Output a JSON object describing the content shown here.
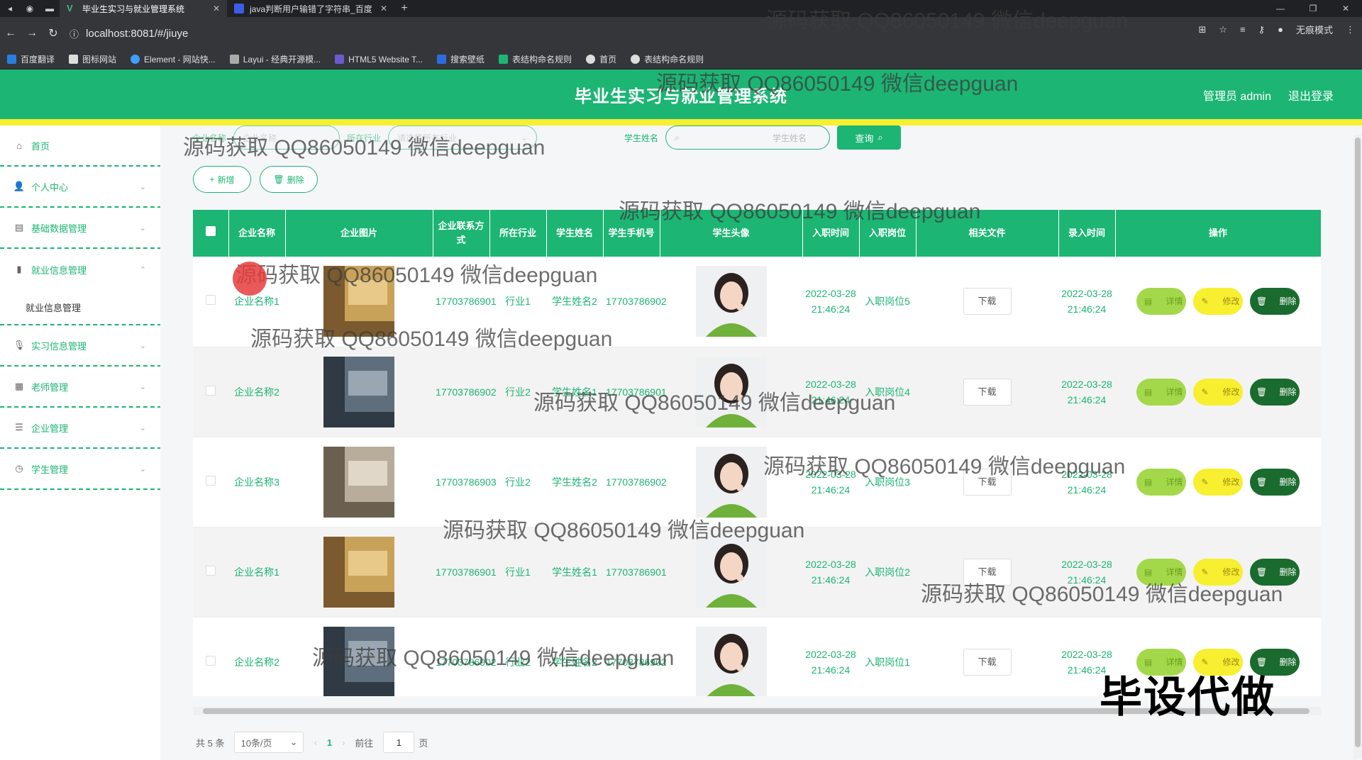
{
  "browser": {
    "tabs": [
      {
        "title": "毕业生实习与就业管理系统",
        "active": true
      },
      {
        "title": "java判断用户输错了字符串_百度",
        "active": false
      }
    ],
    "url": "localhost:8081/#/jiuye",
    "profile": "无痕模式",
    "bookmarks": [
      "百度翻译",
      "图标网站",
      "Element - 网站快...",
      "Layui - 经典开源模...",
      "HTML5 Website T...",
      "搜索壁纸",
      "表结构命名规则",
      "首页",
      "表结构命名规则"
    ]
  },
  "header": {
    "title": "毕业生实习与就业管理系统",
    "user": "管理员 admin",
    "logout": "退出登录"
  },
  "sidebar": {
    "items": [
      {
        "label": "首页",
        "icon": "home-icon"
      },
      {
        "label": "个人中心",
        "icon": "user-icon"
      },
      {
        "label": "基础数据管理",
        "icon": "database-icon"
      },
      {
        "label": "就业信息管理",
        "icon": "chart-icon"
      },
      {
        "label": "实习信息管理",
        "icon": "mic-icon"
      },
      {
        "label": "老师管理",
        "icon": "calendar-icon"
      },
      {
        "label": "企业管理",
        "icon": "list-icon"
      },
      {
        "label": "学生管理",
        "icon": "clock-icon"
      }
    ],
    "sub_item": "就业信息管理"
  },
  "search": {
    "company_label": "企业名称",
    "company_placeholder": "企业名称",
    "industry_label": "所在行业",
    "industry_placeholder": "请选择所在行业",
    "student_label": "学生姓名",
    "student_placeholder": "学生姓名",
    "query_button": "查询"
  },
  "actions": {
    "add": "新增",
    "delete": "删除"
  },
  "table": {
    "headers": [
      "企业名称",
      "企业图片",
      "企业联系方式",
      "所在行业",
      "学生姓名",
      "学生手机号",
      "学生头像",
      "入职时间",
      "入职岗位",
      "相关文件",
      "录入时间",
      "操作"
    ],
    "rows": [
      {
        "company": "企业名称1",
        "contact": "17703786901",
        "industry": "行业1",
        "student": "学生姓名2",
        "phone": "17703786902",
        "join_time": "2022-03-28 21:46:24",
        "position": "入职岗位5",
        "file": "下载",
        "record_time": "2022-03-28 21:46:24"
      },
      {
        "company": "企业名称2",
        "contact": "17703786902",
        "industry": "行业2",
        "student": "学生姓名1",
        "phone": "17703786901",
        "join_time": "2022-03-28 21:46:24",
        "position": "入职岗位4",
        "file": "下载",
        "record_time": "2022-03-28 21:46:24"
      },
      {
        "company": "企业名称3",
        "contact": "17703786903",
        "industry": "行业2",
        "student": "学生姓名2",
        "phone": "17703786902",
        "join_time": "2022-03-28 21:46:24",
        "position": "入职岗位3",
        "file": "下载",
        "record_time": "2022-03-28 21:46:24"
      },
      {
        "company": "企业名称1",
        "contact": "17703786901",
        "industry": "行业1",
        "student": "学生姓名1",
        "phone": "17703786901",
        "join_time": "2022-03-28 21:46:24",
        "position": "入职岗位2",
        "file": "下载",
        "record_time": "2022-03-28 21:46:24"
      },
      {
        "company": "企业名称2",
        "contact": "17703786902",
        "industry": "行业2",
        "student": "学生姓名2",
        "phone": "17703786902",
        "join_time": "2022-03-28 21:46:24",
        "position": "入职岗位1",
        "file": "下载",
        "record_time": "2022-03-28 21:46:24"
      }
    ],
    "op_detail": "详情",
    "op_edit": "修改",
    "op_delete": "删除"
  },
  "pager": {
    "total": "共 5 条",
    "page_size": "10条/页",
    "current": "1",
    "goto_label": "前往",
    "goto_value": "1",
    "page_suffix": "页"
  },
  "watermark": "源码获取 QQ86050149 微信deepguan",
  "corner_text": "毕设代做",
  "colors": {
    "primary": "#1cb574",
    "yellow": "#f7ef30",
    "dark_green": "#1a6b2e"
  }
}
